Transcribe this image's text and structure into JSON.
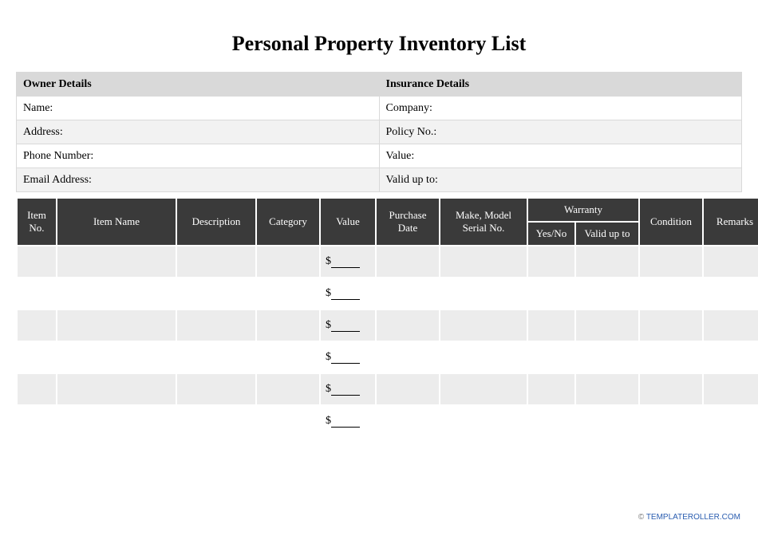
{
  "title": "Personal Property Inventory List",
  "details": {
    "owner_header": "Owner Details",
    "insurance_header": "Insurance Details",
    "rows": [
      {
        "left": "Name:",
        "right": "Company:"
      },
      {
        "left": "Address:",
        "right": "Policy No.:"
      },
      {
        "left": "Phone Number:",
        "right": "Value:"
      },
      {
        "left": "Email Address:",
        "right": "Valid up to:"
      }
    ]
  },
  "inventory": {
    "headers": {
      "item_no": "Item No.",
      "item_name": "Item Name",
      "description": "Description",
      "category": "Category",
      "value": "Value",
      "purchase_date": "Purchase Date",
      "make_model_serial": "Make, Model Serial No.",
      "warranty": "Warranty",
      "warranty_yesno": "Yes/No",
      "warranty_valid": "Valid up to",
      "condition": "Condition",
      "remarks": "Remarks"
    },
    "value_prefix": "$",
    "row_count": 6
  },
  "footer": {
    "copyright": "©",
    "link_text": "TEMPLATEROLLER.COM"
  }
}
